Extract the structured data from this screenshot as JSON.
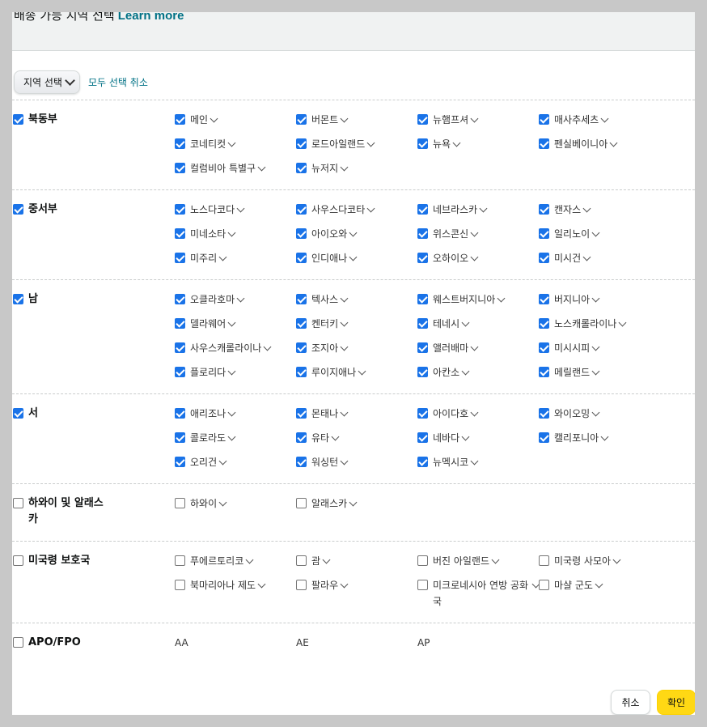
{
  "header": {
    "title": "배송 가능 지역 선택",
    "link": "Learn more"
  },
  "toolbar": {
    "select_label": "지역 선택",
    "clear_label": "모두 선택 취소"
  },
  "groups": [
    {
      "name": "북동부",
      "checked": true,
      "states": [
        {
          "label": "메인",
          "checked": true
        },
        {
          "label": "버몬트",
          "checked": true
        },
        {
          "label": "뉴햄프셔",
          "checked": true
        },
        {
          "label": "매사추세츠",
          "checked": true
        },
        {
          "label": "코네티컷",
          "checked": true
        },
        {
          "label": "로드아일랜드",
          "checked": true
        },
        {
          "label": "뉴욕",
          "checked": true
        },
        {
          "label": "펜실베이니아",
          "checked": true
        },
        {
          "label": "컬럼비아 특별구",
          "checked": true
        },
        {
          "label": "뉴저지",
          "checked": true
        }
      ]
    },
    {
      "name": "중서부",
      "checked": true,
      "states": [
        {
          "label": "노스다코다",
          "checked": true
        },
        {
          "label": "사우스다코타",
          "checked": true
        },
        {
          "label": "네브라스카",
          "checked": true
        },
        {
          "label": "캔자스",
          "checked": true
        },
        {
          "label": "미네소타",
          "checked": true
        },
        {
          "label": "아이오와",
          "checked": true
        },
        {
          "label": "위스콘신",
          "checked": true
        },
        {
          "label": "일리노이",
          "checked": true
        },
        {
          "label": "미주리",
          "checked": true
        },
        {
          "label": "인디애나",
          "checked": true
        },
        {
          "label": "오하이오",
          "checked": true
        },
        {
          "label": "미시건",
          "checked": true
        }
      ]
    },
    {
      "name": "남",
      "checked": true,
      "states": [
        {
          "label": "오클라호마",
          "checked": true
        },
        {
          "label": "텍사스",
          "checked": true
        },
        {
          "label": "웨스트버지니아",
          "checked": true
        },
        {
          "label": "버지니아",
          "checked": true
        },
        {
          "label": "델라웨어",
          "checked": true
        },
        {
          "label": "켄터키",
          "checked": true
        },
        {
          "label": "테네시",
          "checked": true
        },
        {
          "label": "노스캐롤라이나",
          "checked": true
        },
        {
          "label": "사우스캐롤라이나",
          "checked": true
        },
        {
          "label": "조지아",
          "checked": true
        },
        {
          "label": "앨러배마",
          "checked": true
        },
        {
          "label": "미시시피",
          "checked": true
        },
        {
          "label": "플로리다",
          "checked": true
        },
        {
          "label": "루이지애나",
          "checked": true
        },
        {
          "label": "아칸소",
          "checked": true
        },
        {
          "label": "메릴랜드",
          "checked": true
        }
      ]
    },
    {
      "name": "서",
      "checked": true,
      "states": [
        {
          "label": "애리조나",
          "checked": true
        },
        {
          "label": "몬태나",
          "checked": true
        },
        {
          "label": "아이다호",
          "checked": true
        },
        {
          "label": "와이오밍",
          "checked": true
        },
        {
          "label": "콜로라도",
          "checked": true
        },
        {
          "label": "유타",
          "checked": true
        },
        {
          "label": "네바다",
          "checked": true
        },
        {
          "label": "캘리포니아",
          "checked": true
        },
        {
          "label": "오리건",
          "checked": true
        },
        {
          "label": "워싱턴",
          "checked": true
        },
        {
          "label": "뉴멕시코",
          "checked": true
        }
      ]
    },
    {
      "name": "하와이 및 알래스카",
      "checked": false,
      "states": [
        {
          "label": "하와이",
          "checked": false
        },
        {
          "label": "알래스카",
          "checked": false
        }
      ]
    },
    {
      "name": "미국령 보호국",
      "checked": false,
      "states": [
        {
          "label": "푸에르토리코",
          "checked": false
        },
        {
          "label": "괌",
          "checked": false
        },
        {
          "label": "버진 아일랜드",
          "checked": false
        },
        {
          "label": "미국령 사모아",
          "checked": false
        },
        {
          "label": "북마리아나 제도",
          "checked": false
        },
        {
          "label": "팔라우",
          "checked": false
        },
        {
          "label": "미크로네시아 연방 공화국",
          "checked": false
        },
        {
          "label": "마샬 군도",
          "checked": false
        }
      ]
    },
    {
      "name": "APO/FPO",
      "checked": false,
      "plain": true,
      "states": [
        {
          "label": "AA"
        },
        {
          "label": "AE"
        },
        {
          "label": "AP"
        }
      ]
    }
  ],
  "footer": {
    "cancel_label": "취소",
    "ok_label": "확인"
  },
  "colors": {
    "link": "#007185",
    "checkbox": "#1a73e8",
    "primary_button": "#ffd814"
  }
}
